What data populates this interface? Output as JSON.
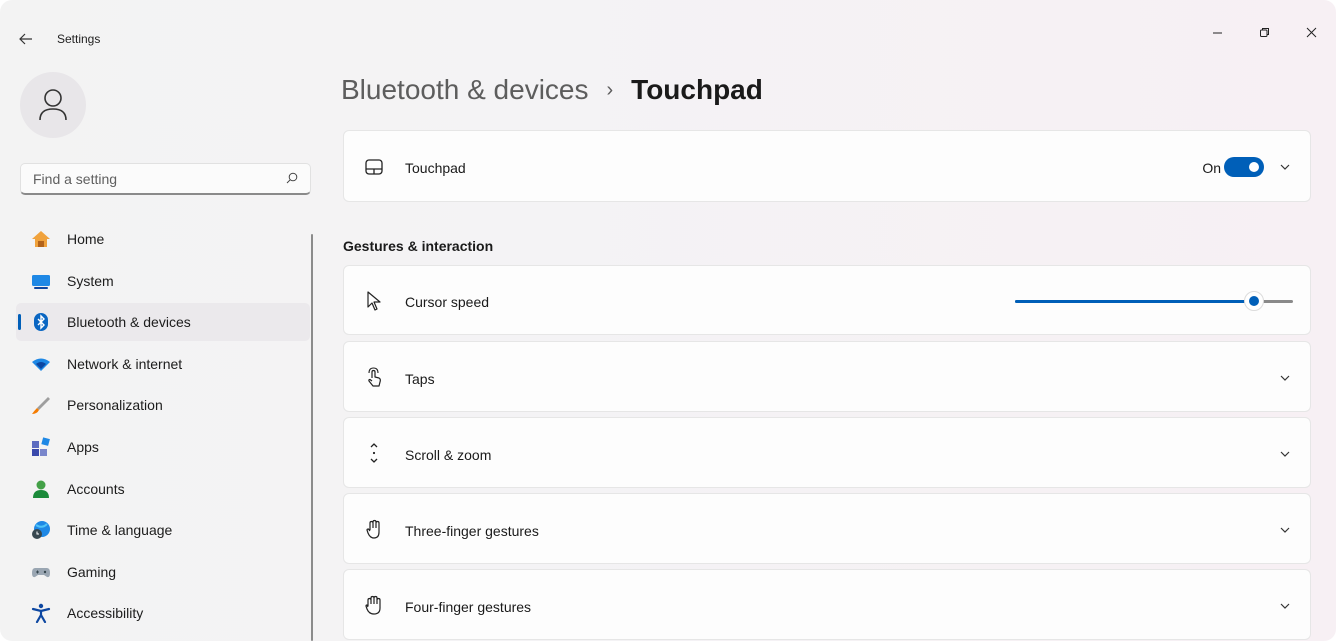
{
  "app": {
    "title": "Settings"
  },
  "window": {
    "minimize": "—",
    "maximize": "❐",
    "close": "✕"
  },
  "search": {
    "placeholder": "Find a setting"
  },
  "sidebar": {
    "items": [
      {
        "label": "Home",
        "icon": "home-icon",
        "active": false
      },
      {
        "label": "System",
        "icon": "system-icon",
        "active": false
      },
      {
        "label": "Bluetooth & devices",
        "icon": "bluetooth-icon",
        "active": true
      },
      {
        "label": "Network & internet",
        "icon": "wifi-icon",
        "active": false
      },
      {
        "label": "Personalization",
        "icon": "brush-icon",
        "active": false
      },
      {
        "label": "Apps",
        "icon": "apps-icon",
        "active": false
      },
      {
        "label": "Accounts",
        "icon": "accounts-icon",
        "active": false
      },
      {
        "label": "Time & language",
        "icon": "globe-clock-icon",
        "active": false
      },
      {
        "label": "Gaming",
        "icon": "gamepad-icon",
        "active": false
      },
      {
        "label": "Accessibility",
        "icon": "accessibility-icon",
        "active": false
      }
    ]
  },
  "breadcrumb": {
    "parent": "Bluetooth & devices",
    "separator": "›",
    "current": "Touchpad"
  },
  "touchpad": {
    "label": "Touchpad",
    "toggle_state": "On",
    "toggle_on": true
  },
  "section": {
    "title": "Gestures & interaction"
  },
  "cursor_speed": {
    "label": "Cursor speed",
    "value_fraction": 0.86
  },
  "cards": [
    {
      "label": "Taps",
      "icon": "tap-icon"
    },
    {
      "label": "Scroll & zoom",
      "icon": "scroll-icon"
    },
    {
      "label": "Three-finger gestures",
      "icon": "three-finger-icon"
    },
    {
      "label": "Four-finger gestures",
      "icon": "four-finger-icon"
    }
  ],
  "colors": {
    "accent": "#005fb8"
  }
}
